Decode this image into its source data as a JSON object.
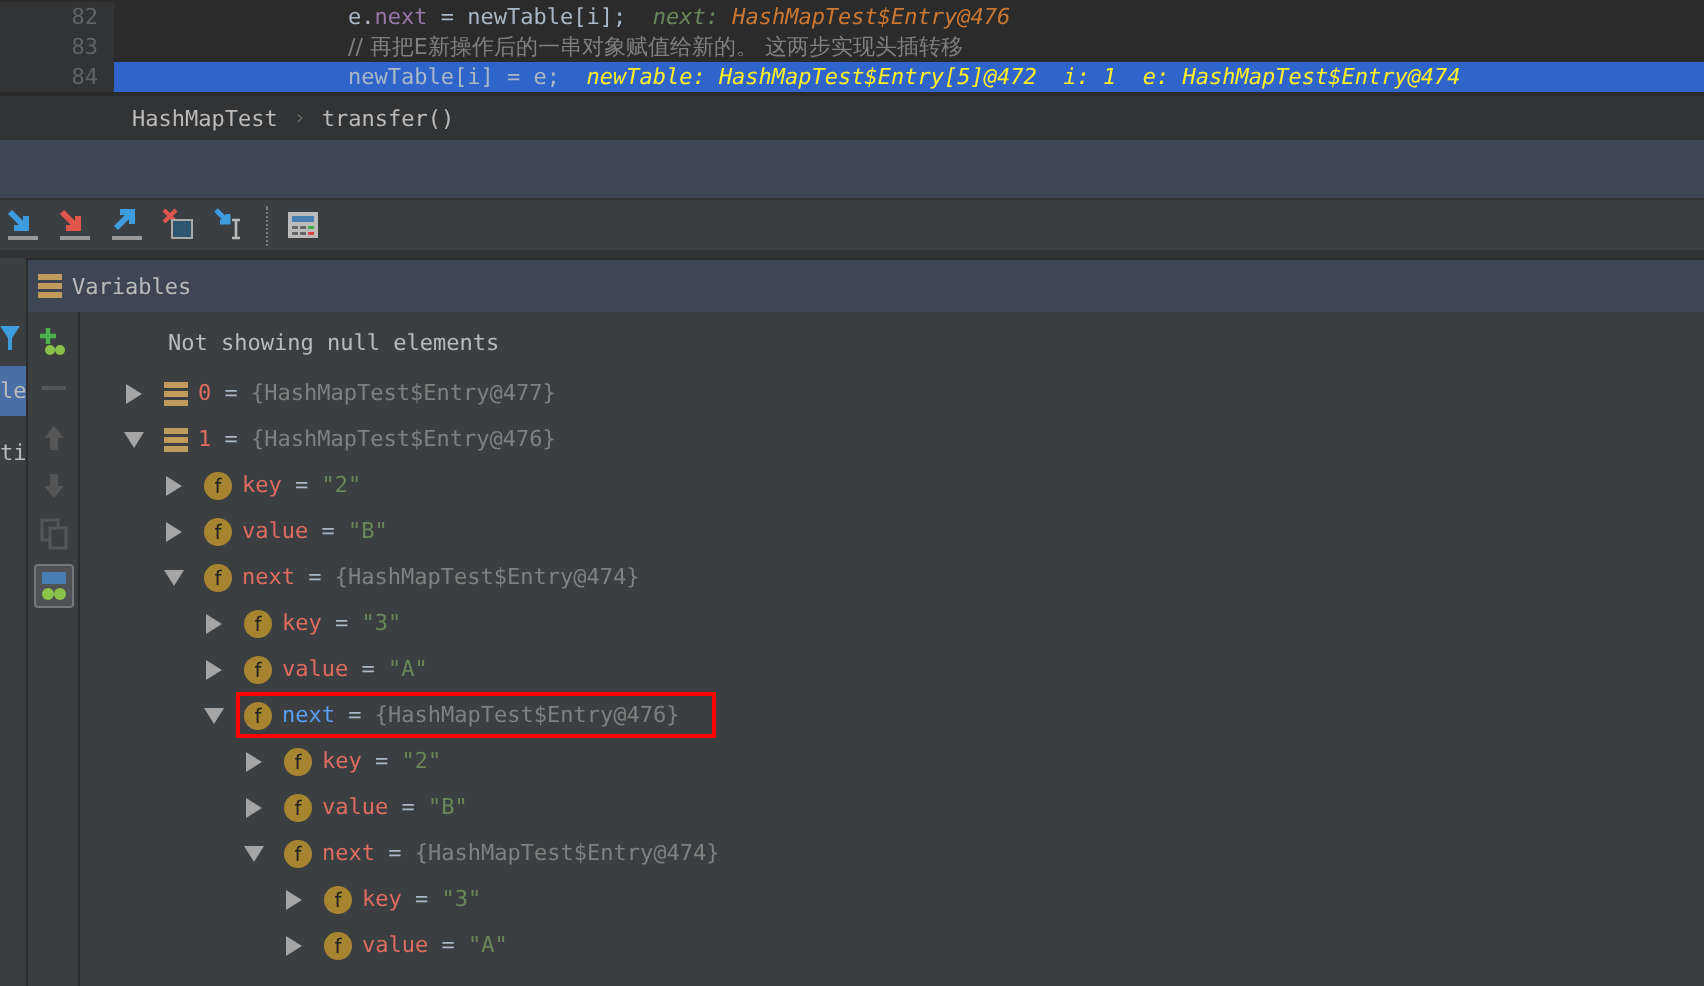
{
  "editor": {
    "lines": [
      {
        "number": "82",
        "selected": false,
        "segments": [
          {
            "kind": "code",
            "text": "e."
          },
          {
            "kind": "field",
            "text": "next"
          },
          {
            "kind": "code",
            "text": " = newTable[i];"
          },
          {
            "kind": "debug-name",
            "text": "  next: "
          },
          {
            "kind": "debug-value",
            "text": "HashMapTest$Entry@476"
          }
        ]
      },
      {
        "number": "83",
        "selected": false,
        "segments": [
          {
            "kind": "comment",
            "text": "// 再把E新操作后的一串对象赋值给新的。 这两步实现头插转移"
          }
        ]
      },
      {
        "number": "84",
        "selected": true,
        "segments": [
          {
            "kind": "code",
            "text": "newTable[i] = e;"
          },
          {
            "kind": "debug-selected",
            "text": "  newTable: HashMapTest$Entry[5]@472  i: 1  e: HashMapTest$Entry@474"
          }
        ]
      }
    ]
  },
  "breadcrumb": [
    "HashMapTest",
    "transfer()"
  ],
  "breadcrumb_separator": "›",
  "panel": {
    "title": "Variables",
    "side_tabs": [
      {
        "label": "le",
        "selected": true
      },
      {
        "label": "ti",
        "selected": false
      }
    ]
  },
  "tree": {
    "note": "Not showing null elements",
    "nodes": [
      {
        "kind": "array",
        "name": "0",
        "operator": "=",
        "value": "{HashMapTest$Entry@477}",
        "expanded": false,
        "highlighted": false
      },
      {
        "kind": "array",
        "name": "1",
        "operator": "=",
        "value": "{HashMapTest$Entry@476}",
        "expanded": true,
        "highlighted": false,
        "children": [
          {
            "kind": "field",
            "icon_letter": "f",
            "name": "key",
            "operator": "=",
            "value": "\"2\"",
            "expanded": false,
            "highlighted": false
          },
          {
            "kind": "field",
            "icon_letter": "f",
            "name": "value",
            "operator": "=",
            "value": "\"B\"",
            "expanded": false,
            "highlighted": false
          },
          {
            "kind": "field",
            "icon_letter": "f",
            "name": "next",
            "operator": "=",
            "value": "{HashMapTest$Entry@474}",
            "expanded": true,
            "highlighted": false,
            "children": [
              {
                "kind": "field",
                "icon_letter": "f",
                "name": "key",
                "operator": "=",
                "value": "\"3\"",
                "expanded": false,
                "highlighted": false
              },
              {
                "kind": "field",
                "icon_letter": "f",
                "name": "value",
                "operator": "=",
                "value": "\"A\"",
                "expanded": false,
                "highlighted": false
              },
              {
                "kind": "field",
                "icon_letter": "f",
                "name": "next",
                "operator": "=",
                "value": "{HashMapTest$Entry@476}",
                "expanded": true,
                "highlighted": true,
                "children": [
                  {
                    "kind": "field",
                    "icon_letter": "f",
                    "name": "key",
                    "operator": "=",
                    "value": "\"2\"",
                    "expanded": false,
                    "highlighted": false
                  },
                  {
                    "kind": "field",
                    "icon_letter": "f",
                    "name": "value",
                    "operator": "=",
                    "value": "\"B\"",
                    "expanded": false,
                    "highlighted": false
                  },
                  {
                    "kind": "field",
                    "icon_letter": "f",
                    "name": "next",
                    "operator": "=",
                    "value": "{HashMapTest$Entry@474}",
                    "expanded": true,
                    "highlighted": false,
                    "children": [
                      {
                        "kind": "field",
                        "icon_letter": "f",
                        "name": "key",
                        "operator": "=",
                        "value": "\"3\"",
                        "expanded": false,
                        "highlighted": false
                      },
                      {
                        "kind": "field",
                        "icon_letter": "f",
                        "name": "value",
                        "operator": "=",
                        "value": "\"A\"",
                        "expanded": false,
                        "highlighted": false
                      }
                    ]
                  }
                ]
              }
            ]
          }
        ]
      }
    ]
  }
}
